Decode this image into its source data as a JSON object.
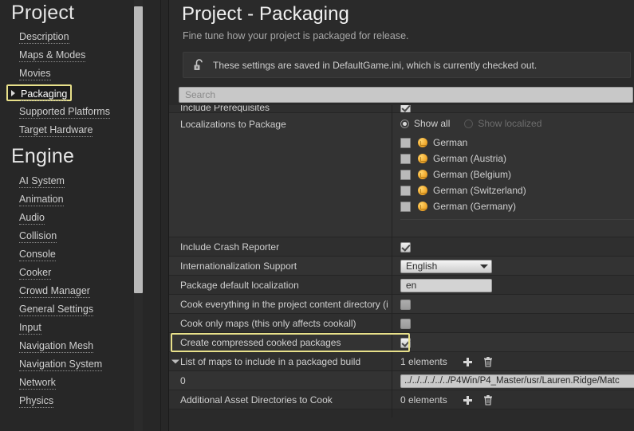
{
  "sidebar": {
    "sections": [
      {
        "title": "Project",
        "items": [
          {
            "label": "Description",
            "selected": false
          },
          {
            "label": "Maps & Modes",
            "selected": false
          },
          {
            "label": "Movies",
            "selected": false
          },
          {
            "label": "Packaging",
            "selected": true
          },
          {
            "label": "Supported Platforms",
            "selected": false
          },
          {
            "label": "Target Hardware",
            "selected": false
          }
        ]
      },
      {
        "title": "Engine",
        "items": [
          {
            "label": "AI System",
            "selected": false
          },
          {
            "label": "Animation",
            "selected": false
          },
          {
            "label": "Audio",
            "selected": false
          },
          {
            "label": "Collision",
            "selected": false
          },
          {
            "label": "Console",
            "selected": false
          },
          {
            "label": "Cooker",
            "selected": false
          },
          {
            "label": "Crowd Manager",
            "selected": false
          },
          {
            "label": "General Settings",
            "selected": false
          },
          {
            "label": "Input",
            "selected": false
          },
          {
            "label": "Navigation Mesh",
            "selected": false
          },
          {
            "label": "Navigation System",
            "selected": false
          },
          {
            "label": "Network",
            "selected": false
          },
          {
            "label": "Physics",
            "selected": false
          }
        ]
      }
    ]
  },
  "header": {
    "title": "Project - Packaging",
    "subtitle": "Fine tune how your project is packaged for release.",
    "notice_text": "These settings are saved in DefaultGame.ini, which is currently checked out.",
    "notice_icon": "unlocked-padlock-icon"
  },
  "search": {
    "placeholder": "Search",
    "value": ""
  },
  "details": {
    "clipped_row": {
      "label": "Include Prerequisites",
      "checked": true
    },
    "localizations": {
      "label": "Localizations to Package",
      "radios": [
        {
          "label": "Show all",
          "selected": true
        },
        {
          "label": "Show localized",
          "selected": false
        }
      ],
      "locales": [
        {
          "label": "German",
          "checked": false
        },
        {
          "label": "German (Austria)",
          "checked": false
        },
        {
          "label": "German (Belgium)",
          "checked": false
        },
        {
          "label": "German (Switzerland)",
          "checked": false
        },
        {
          "label": "German (Germany)",
          "checked": false
        }
      ]
    },
    "rows": [
      {
        "label": "Include Crash Reporter",
        "type": "checkbox",
        "checked": true
      },
      {
        "label": "Internationalization Support",
        "type": "combo",
        "value": "English"
      },
      {
        "label": "Package default localization",
        "type": "text",
        "value": "en"
      },
      {
        "label": "Cook everything in the project content directory (i",
        "type": "checkbox",
        "checked": false
      },
      {
        "label": "Cook only maps (this only affects cookall)",
        "type": "checkbox",
        "checked": false
      },
      {
        "label": "Create compressed cooked packages",
        "type": "checkbox",
        "checked": true,
        "highlighted": true
      }
    ],
    "array_rows": [
      {
        "label": "List of maps to include in a packaged build",
        "count": "1 elements",
        "expander": true
      },
      {
        "label": "Additional Asset Directories to Cook",
        "count": "0 elements",
        "expander": false
      }
    ],
    "map_entry": {
      "index": "0",
      "path": "../../../../../../P4Win/P4_Master/usr/Lauren.Ridge/Matc"
    },
    "add_icon": "plus-icon",
    "delete_icon": "trash-icon"
  },
  "colors": {
    "highlight": "#e8e08a",
    "panel_bg": "#2a2a2a",
    "sidebar_bg": "#272727",
    "row_odd": "#2f2f2f",
    "row_even": "#333333",
    "flag_accent": "#f0a82c"
  }
}
